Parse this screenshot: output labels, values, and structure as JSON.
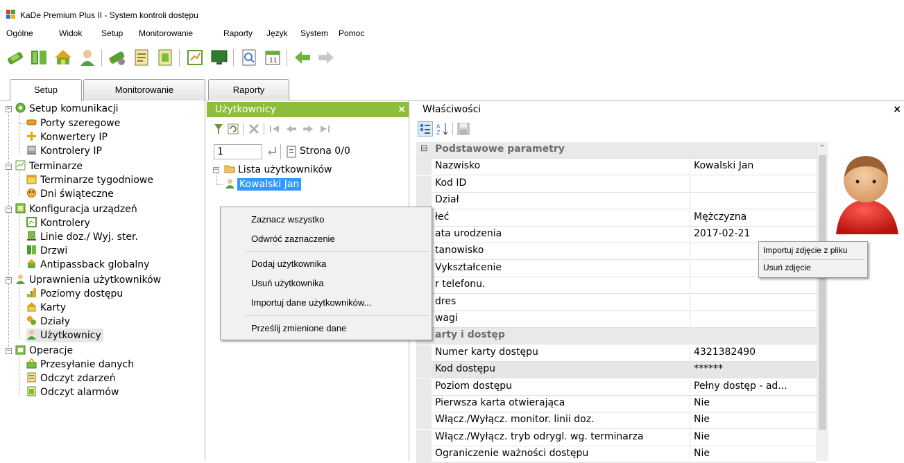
{
  "window": {
    "title": "KaDe Premium Plus II - System kontroli dostępu"
  },
  "menu": [
    "Ogólne",
    "Widok",
    "Setup",
    "Monitorowanie",
    "Raporty",
    "Język",
    "System",
    "Pomoc"
  ],
  "tabs": [
    "Setup",
    "Monitorowanie",
    "Raporty"
  ],
  "tree": {
    "setup_kom": "Setup komunikacji",
    "porty": "Porty szeregowe",
    "konwertery": "Konwertery IP",
    "kontrolery_ip": "Kontrolery IP",
    "terminarze": "Terminarze",
    "terminarze_tyg": "Terminarze tygodniowe",
    "dni": "Dni świąteczne",
    "konfiguracja": "Konfiguracja urządzeń",
    "kontrolery": "Kontrolery",
    "linie": "Linie doz./ Wyj. ster.",
    "drzwi": "Drzwi",
    "antipassback": "Antipassback globalny",
    "uprawnienia": "Uprawnienia użytkowników",
    "poziomy": "Poziomy dostępu",
    "karty": "Karty",
    "dzialy": "Działy",
    "uzytkownicy": "Użytkownicy",
    "operacje": "Operacje",
    "przesylanie": "Przesyłanie danych",
    "zdarzenia": "Odczyt zdarzeń",
    "alarmy": "Odczyt alarmów"
  },
  "users_panel": {
    "title": "Użytkownicy",
    "close": "×",
    "page_input": "1",
    "page_label": "Strona 0/0",
    "list_root": "Lista użytkowników",
    "user": "Kowalski Jan"
  },
  "context_menu": {
    "items": [
      "Zaznacz wszystko",
      "Odwróć zaznaczenie",
      "Dodaj użytkownika",
      "Usuń użytkownika",
      "Importuj dane użytkowników...",
      "Prześlij zmienione dane"
    ]
  },
  "photo_menu": {
    "items": [
      "Importuj zdjęcie z pliku",
      "Usuń zdjęcie"
    ]
  },
  "properties": {
    "title": "Właściwości",
    "close": "×",
    "cat1": "Podstawowe parametry",
    "cat1_toggle": "⊟",
    "cat2": "arty i dostęp",
    "rows1": [
      {
        "label": "Nazwisko",
        "value": "Kowalski Jan"
      },
      {
        "label": "Kod ID",
        "value": ""
      },
      {
        "label": "Dział",
        "value": ""
      },
      {
        "label": "łeć",
        "value": "Mężczyzna"
      },
      {
        "label": "ata urodzenia",
        "value": "2017-02-21"
      },
      {
        "label": "tanowisko",
        "value": ""
      },
      {
        "label": "Vykształcenie",
        "value": ""
      },
      {
        "label": "r telefonu.",
        "value": ""
      },
      {
        "label": "dres",
        "value": ""
      },
      {
        "label": "wagi",
        "value": ""
      }
    ],
    "rows2": [
      {
        "label": "Numer karty dostępu",
        "value": "4321382490"
      },
      {
        "label": "Kod dostępu",
        "value": "******"
      },
      {
        "label": "Poziom dostępu",
        "value": "Pełny dostęp - ad..."
      },
      {
        "label": "Pierwsza karta otwierająca",
        "value": "Nie"
      },
      {
        "label": "Włącz./Wyłącz. monitor. linii doz.",
        "value": "Nie"
      },
      {
        "label": "Włącz./Wyłącz. tryb odrygl. wg. terminarza",
        "value": "Nie"
      },
      {
        "label": "Ograniczenie ważności dostępu",
        "value": "Nie"
      }
    ]
  },
  "colors": {
    "panel_header": "#8cbe3c",
    "selection": "#3399ff"
  }
}
